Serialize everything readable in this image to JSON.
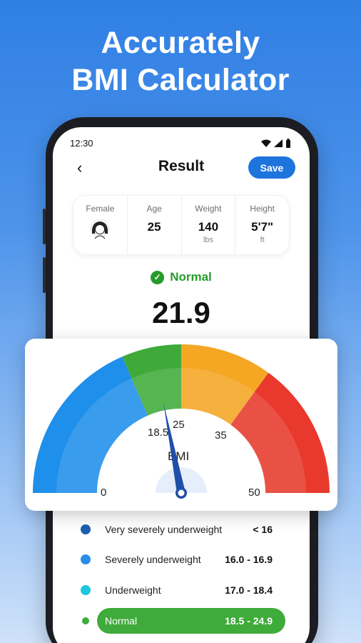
{
  "headline": {
    "line1": "Accurately",
    "line2": "BMI Calculator"
  },
  "status_bar": {
    "time": "12:30",
    "icons": [
      "wifi-icon",
      "signal-icon",
      "battery-icon"
    ]
  },
  "app_bar": {
    "back_icon": "chevron-left-icon",
    "title": "Result",
    "save_label": "Save",
    "save_color": "#1e74dd"
  },
  "profile": {
    "gender_label": "Female",
    "avatar_icon": "female-avatar-icon",
    "age_label": "Age",
    "age_value": "25",
    "weight_label": "Weight",
    "weight_value": "140",
    "weight_unit": "lbs",
    "height_label": "Height",
    "height_value": "5'7\"",
    "height_unit": "ft"
  },
  "result": {
    "status": "Normal",
    "status_color": "#279b2c",
    "bmi": "21.9"
  },
  "gauge": {
    "min_label": "0",
    "max_label": "50",
    "label": "BMI",
    "tick_labels": [
      "18.5",
      "25",
      "35"
    ],
    "needle_value": 21.9,
    "segments": [
      {
        "from": 0,
        "to": 18.5,
        "color": "#1e8fea"
      },
      {
        "from": 18.5,
        "to": 25,
        "color": "#3faa3a"
      },
      {
        "from": 25,
        "to": 35,
        "color": "#f5a623"
      },
      {
        "from": 35,
        "to": 50,
        "color": "#e8392c"
      }
    ],
    "needle_color": "#1f4fa8"
  },
  "ranges": [
    {
      "label": "Very severely underweight",
      "value": "< 16",
      "color": "#1c5fb0",
      "active": false
    },
    {
      "label": "Severely underweight",
      "value": "16.0 - 16.9",
      "color": "#2a8fe8",
      "active": false
    },
    {
      "label": "Underweight",
      "value": "17.0 - 18.4",
      "color": "#1fc6e0",
      "active": false
    },
    {
      "label": "Normal",
      "value": "18.5 - 24.9",
      "color": "#3fab3a",
      "active": true
    }
  ]
}
